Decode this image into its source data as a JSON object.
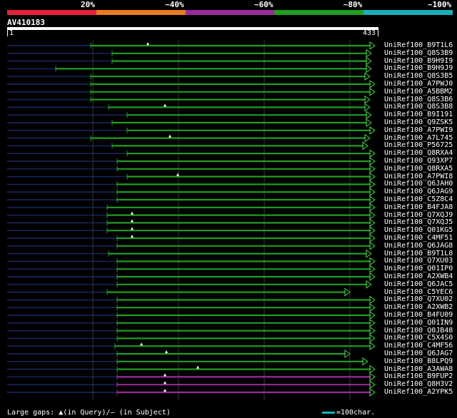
{
  "legend": {
    "labels": [
      "20%",
      "~40%",
      "~60%",
      "~80%",
      "~100%"
    ],
    "colors": [
      "#e8203a",
      "#e87c1e",
      "#9a2a9a",
      "#1f9e1f",
      "#19b0b8"
    ]
  },
  "query": {
    "id": "AV410183",
    "start": "1",
    "end": "433"
  },
  "hits": [
    {
      "name": "UniRef100_B9T1L6",
      "start": 127,
      "end": 525,
      "color": "#1f9e1f",
      "tri": 207
    },
    {
      "name": "UniRef100_Q8S3B9",
      "start": 157,
      "end": 520,
      "color": "#1f9e1f"
    },
    {
      "name": "UniRef100_B9H9I9",
      "start": 157,
      "end": 520,
      "color": "#1f9e1f"
    },
    {
      "name": "UniRef100_B9H9J9",
      "start": 78,
      "end": 520,
      "color": "#1f9e1f"
    },
    {
      "name": "UniRef100_Q8S3B5",
      "start": 127,
      "end": 518,
      "color": "#1f9e1f"
    },
    {
      "name": "UniRef100_A7PWJ0",
      "start": 127,
      "end": 525,
      "color": "#1f9e1f"
    },
    {
      "name": "UniRef100_A5BBM2",
      "start": 127,
      "end": 525,
      "color": "#1f9e1f"
    },
    {
      "name": "UniRef100_Q8S3B6",
      "start": 127,
      "end": 518,
      "color": "#1f9e1f"
    },
    {
      "name": "UniRef100_Q8S3B8",
      "start": 152,
      "end": 518,
      "color": "#1f9e1f",
      "tri": 231
    },
    {
      "name": "UniRef100_B9I191",
      "start": 178,
      "end": 520,
      "color": "#1f9e1f"
    },
    {
      "name": "UniRef100_Q9ZSK5",
      "start": 157,
      "end": 520,
      "color": "#1f9e1f"
    },
    {
      "name": "UniRef100_A7PWI9",
      "start": 178,
      "end": 525,
      "color": "#1f9e1f"
    },
    {
      "name": "UniRef100_A7L745",
      "start": 127,
      "end": 518,
      "color": "#1f9e1f",
      "tri": 238
    },
    {
      "name": "UniRef100_P56725",
      "start": 157,
      "end": 515,
      "color": "#1f9e1f"
    },
    {
      "name": "UniRef100_Q8RXA4",
      "start": 178,
      "end": 525,
      "color": "#1f9e1f"
    },
    {
      "name": "UniRef100_Q93XP7",
      "start": 164,
      "end": 525,
      "color": "#1f9e1f"
    },
    {
      "name": "UniRef100_Q8RXA5",
      "start": 164,
      "end": 525,
      "color": "#1f9e1f"
    },
    {
      "name": "UniRef100_A7PWI8",
      "start": 178,
      "end": 525,
      "color": "#1f9e1f",
      "tri": 249
    },
    {
      "name": "UniRef100_Q6JAH0",
      "start": 164,
      "end": 525,
      "color": "#1f9e1f"
    },
    {
      "name": "UniRef100_Q6JAG9",
      "start": 164,
      "end": 525,
      "color": "#1f9e1f"
    },
    {
      "name": "UniRef100_C5Z8C4",
      "start": 164,
      "end": 525,
      "color": "#1f9e1f"
    },
    {
      "name": "UniRef100_B4FJA8",
      "start": 150,
      "end": 525,
      "color": "#1f9e1f"
    },
    {
      "name": "UniRef100_Q7XQJ9",
      "start": 150,
      "end": 525,
      "color": "#1f9e1f",
      "tri": 185
    },
    {
      "name": "UniRef100_Q7XQJ5",
      "start": 150,
      "end": 525,
      "color": "#1f9e1f",
      "tri": 185
    },
    {
      "name": "UniRef100_Q01KG5",
      "start": 150,
      "end": 525,
      "color": "#1f9e1f",
      "tri": 185
    },
    {
      "name": "UniRef100_C4MF51",
      "start": 164,
      "end": 525,
      "color": "#1f9e1f",
      "tri": 185
    },
    {
      "name": "UniRef100_Q6JAG8",
      "start": 164,
      "end": 525,
      "color": "#1f9e1f"
    },
    {
      "name": "UniRef100_B9T1L8",
      "start": 152,
      "end": 520,
      "color": "#1f9e1f"
    },
    {
      "name": "UniRef100_Q7XU03",
      "start": 164,
      "end": 525,
      "color": "#1f9e1f"
    },
    {
      "name": "UniRef100_Q01IP0",
      "start": 164,
      "end": 525,
      "color": "#1f9e1f"
    },
    {
      "name": "UniRef100_A2XWB4",
      "start": 164,
      "end": 525,
      "color": "#1f9e1f"
    },
    {
      "name": "UniRef100_Q6JAC5",
      "start": 164,
      "end": 520,
      "color": "#1f9e1f"
    },
    {
      "name": "UniRef100_C5YEC6",
      "start": 150,
      "end": 490,
      "color": "#1f9e1f"
    },
    {
      "name": "UniRef100_Q7XU02",
      "start": 164,
      "end": 525,
      "color": "#1f9e1f"
    },
    {
      "name": "UniRef100_A2XWB2",
      "start": 164,
      "end": 525,
      "color": "#1f9e1f"
    },
    {
      "name": "UniRef100_B4FU09",
      "start": 164,
      "end": 525,
      "color": "#1f9e1f"
    },
    {
      "name": "UniRef100_Q01IN9",
      "start": 164,
      "end": 525,
      "color": "#1f9e1f"
    },
    {
      "name": "UniRef100_Q0JB48",
      "start": 164,
      "end": 525,
      "color": "#1f9e1f"
    },
    {
      "name": "UniRef100_C5X4S0",
      "start": 164,
      "end": 525,
      "color": "#1f9e1f"
    },
    {
      "name": "UniRef100_C4MF56",
      "start": 161,
      "end": 525,
      "color": "#1f9e1f",
      "tri": 198
    },
    {
      "name": "UniRef100_Q6JAG7",
      "start": 164,
      "end": 490,
      "color": "#1f9e1f",
      "tri": 233
    },
    {
      "name": "UniRef100_B8LPQ9",
      "start": 164,
      "end": 515,
      "color": "#1f9e1f"
    },
    {
      "name": "UniRef100_A3AWA8",
      "start": 164,
      "end": 525,
      "color": "#1f9e1f",
      "tri": 277
    },
    {
      "name": "UniRef100_B9FUP2",
      "start": 164,
      "end": 525,
      "color": "#9a2a9a",
      "tri": 231
    },
    {
      "name": "UniRef100_Q8H3V2",
      "start": 164,
      "end": 525,
      "color": "#9a2a9a",
      "tri": 231
    },
    {
      "name": "UniRef100_A2YPK5",
      "start": 164,
      "end": 525,
      "color": "#9a2a9a",
      "tri": 231
    }
  ],
  "footer": {
    "gaps_prefix": "Large gaps:",
    "gaps_query": "(in Query)/",
    "gaps_subject": "(in Subject)",
    "scale_label": "=100char."
  }
}
